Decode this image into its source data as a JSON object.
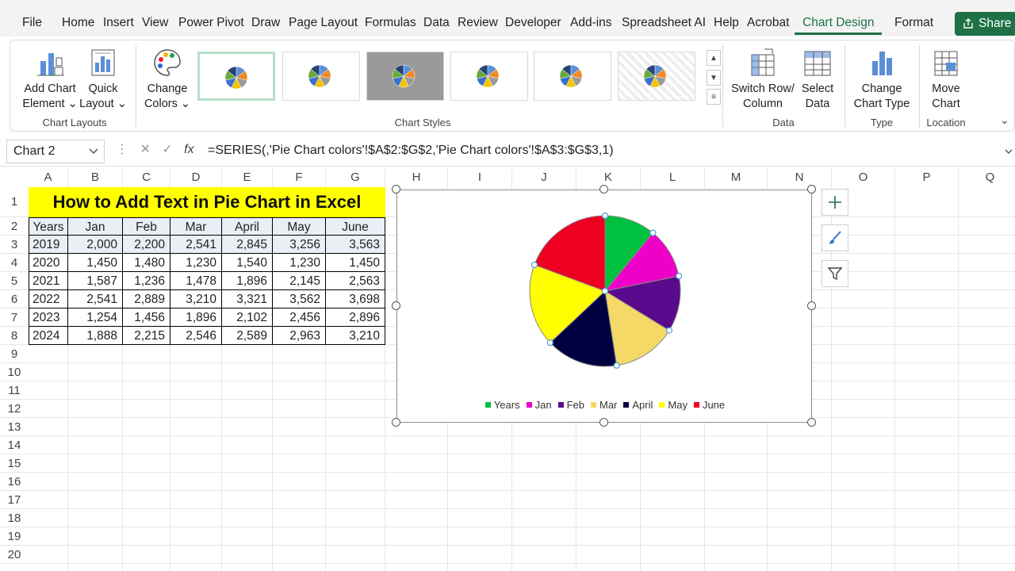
{
  "menu": {
    "tabs": [
      "File",
      "Home",
      "Insert",
      "View",
      "Power Pivot",
      "Draw",
      "Page Layout",
      "Formulas",
      "Data",
      "Review",
      "Developer",
      "Add-ins",
      "Spreadsheet AI",
      "Help",
      "Acrobat",
      "Chart Design",
      "Format"
    ],
    "active_tab": "Chart Design",
    "share_label": "Share"
  },
  "ribbon": {
    "add_chart_element": [
      "Add Chart",
      "Element ⌄"
    ],
    "quick_layout": [
      "Quick",
      "Layout ⌄"
    ],
    "change_colors": [
      "Change",
      "Colors ⌄"
    ],
    "switch_row_column": [
      "Switch Row/",
      "Column"
    ],
    "select_data": [
      "Select",
      "Data"
    ],
    "change_chart_type": [
      "Change",
      "Chart Type"
    ],
    "move_chart": [
      "Move",
      "Chart"
    ],
    "groups": {
      "chart_layouts": "Chart Layouts",
      "chart_styles": "Chart Styles",
      "data": "Data",
      "type": "Type",
      "location": "Location"
    }
  },
  "formula_bar": {
    "name_box": "Chart 2",
    "formula": "=SERIES(,'Pie Chart colors'!$A$2:$G$2,'Pie Chart colors'!$A$3:$G$3,1)"
  },
  "sheet": {
    "columns": [
      "A",
      "B",
      "C",
      "D",
      "E",
      "F",
      "G",
      "H",
      "I",
      "J",
      "K",
      "L",
      "M",
      "N",
      "O",
      "P",
      "Q"
    ],
    "rows": [
      "1",
      "2",
      "3",
      "4",
      "5",
      "6",
      "7",
      "8",
      "9",
      "10",
      "11",
      "12",
      "13",
      "14",
      "15",
      "16",
      "17",
      "18",
      "19",
      "20"
    ],
    "title": "How to Add Text in Pie Chart in Excel",
    "headers": [
      "Years",
      "Jan",
      "Feb",
      "Mar",
      "April",
      "May",
      "June"
    ],
    "data": [
      [
        "2019",
        "2,000",
        "2,200",
        "2,541",
        "2,845",
        "3,256",
        "3,563"
      ],
      [
        "2020",
        "1,450",
        "1,480",
        "1,230",
        "1,540",
        "1,230",
        "1,450"
      ],
      [
        "2021",
        "1,587",
        "1,236",
        "1,478",
        "1,896",
        "2,145",
        "2,563"
      ],
      [
        "2022",
        "2,541",
        "2,889",
        "3,210",
        "3,321",
        "3,562",
        "3,698"
      ],
      [
        "2023",
        "1,254",
        "1,456",
        "1,896",
        "2,102",
        "2,456",
        "2,896"
      ],
      [
        "2024",
        "1,888",
        "2,215",
        "2,546",
        "2,589",
        "2,963",
        "3,210"
      ]
    ]
  },
  "chart_data": {
    "type": "pie",
    "categories": [
      "Years",
      "Jan",
      "Feb",
      "Mar",
      "April",
      "May",
      "June"
    ],
    "values": [
      2019,
      2000,
      2200,
      2541,
      2845,
      3256,
      3563
    ],
    "colors": [
      "#00c040",
      "#ee00c8",
      "#5a0a8c",
      "#f5d966",
      "#000040",
      "#ffff00",
      "#ee0022"
    ],
    "legend": "bottom"
  }
}
